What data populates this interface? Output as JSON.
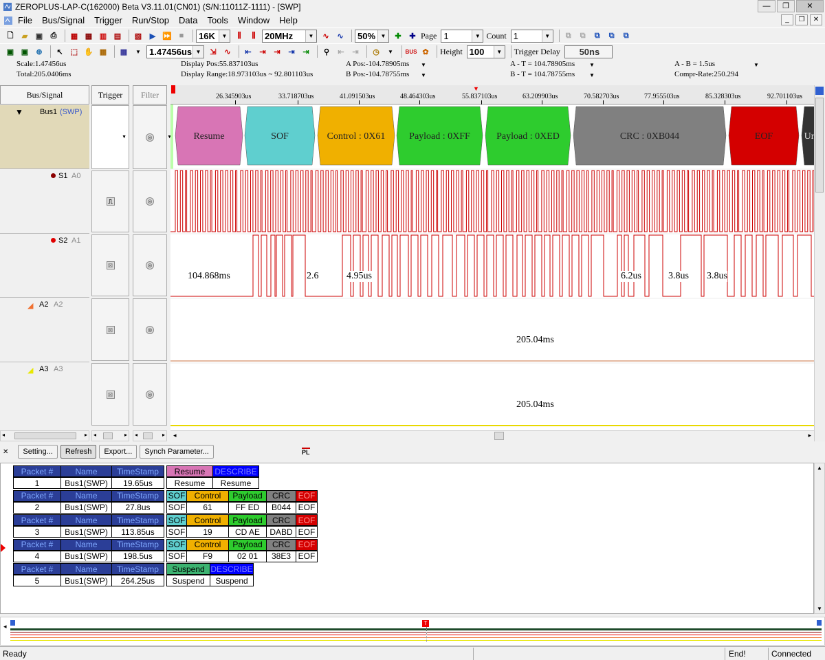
{
  "window": {
    "title": "ZEROPLUS-LAP-C(162000) Beta V3.11.01(CN01) (S/N:11011Z-1111) - [SWP]"
  },
  "menu": [
    "File",
    "Bus/Signal",
    "Trigger",
    "Run/Stop",
    "Data",
    "Tools",
    "Window",
    "Help"
  ],
  "toolbar": {
    "memory": "16K",
    "frequency": "20MHz",
    "zoom": "50%",
    "page_label": "Page",
    "page_value": "1",
    "count_label": "Count",
    "count_value": "1",
    "scale_value": "1.47456us",
    "height_label": "Height",
    "height_value": "100",
    "trigger_delay_label": "Trigger Delay",
    "trigger_delay_value": "50ns"
  },
  "info": {
    "scale": "Scale:1.47456us",
    "total": "Total:205.0406ms",
    "display_pos": "Display Pos:55.837103us",
    "display_range": "Display Range:18.973103us ~ 92.801103us",
    "a_pos": "A Pos:-104.78905ms",
    "b_pos": "B Pos:-104.78755ms",
    "a_t": "A - T = 104.78905ms",
    "b_t": "B - T = 104.78755ms",
    "a_b": "A - B = 1.5us",
    "compr": "Compr-Rate:250.294"
  },
  "headers": {
    "bus_signal": "Bus/Signal",
    "trigger": "Trigger",
    "filter": "Filter"
  },
  "signals": [
    {
      "name": "Bus1",
      "sub": "(SWP)"
    },
    {
      "name": "S1",
      "sub": "A0",
      "color": "#8b0000"
    },
    {
      "name": "S2",
      "sub": "A1",
      "color": "#e00000"
    },
    {
      "name": "A2",
      "sub": "A2",
      "color": "#f07030"
    },
    {
      "name": "A3",
      "sub": "A3",
      "color": "#f0f000"
    }
  ],
  "ruler_ticks": [
    "26.345903us",
    "33.718703us",
    "41.091503us",
    "48.464303us",
    "55.837103us",
    "63.209903us",
    "70.582703us",
    "77.955503us",
    "85.328303us",
    "92.701103us"
  ],
  "bus_segments": [
    {
      "label": "Resume",
      "color": "#d875b5"
    },
    {
      "label": "SOF",
      "color": "#5fcfcf"
    },
    {
      "label": "Control : 0X61",
      "color": "#f0b000"
    },
    {
      "label": "Payload : 0XFF",
      "color": "#2ecc2e"
    },
    {
      "label": "Payload : 0XED",
      "color": "#2ecc2e"
    },
    {
      "label": "CRC : 0XB044",
      "color": "#808080"
    },
    {
      "label": "EOF",
      "color": "#d40000"
    },
    {
      "label": "Ur",
      "color": "#333333"
    }
  ],
  "s2_labels": [
    "104.868ms",
    "2.6",
    "4.95us",
    "6.2us",
    "3.8us",
    "3.8us"
  ],
  "a2_label": "205.04ms",
  "a3_label": "205.04ms",
  "buttons": {
    "setting": "Setting...",
    "refresh": "Refresh",
    "export": "Export...",
    "synch": "Synch Parameter..."
  },
  "pl_label": "PL",
  "packet_headers": {
    "num": "Packet #",
    "name": "Name",
    "ts": "TimeStamp"
  },
  "packets": [
    {
      "num": "1",
      "name": "Bus1(SWP)",
      "ts": "19.65us",
      "fields": [
        {
          "h": "Resume",
          "v": "Resume",
          "color": "#d875b5"
        },
        {
          "h": "DESCRIBE",
          "v": "Resume",
          "color": "#0000ff"
        }
      ]
    },
    {
      "num": "2",
      "name": "Bus1(SWP)",
      "ts": "27.8us",
      "fields": [
        {
          "h": "SOF",
          "v": "SOF",
          "color": "#5fcfcf"
        },
        {
          "h": "Control",
          "v": "61",
          "color": "#f0b000"
        },
        {
          "h": "Payload",
          "v": "FF  ED",
          "color": "#2ecc2e"
        },
        {
          "h": "CRC",
          "v": "B044",
          "color": "#808080"
        },
        {
          "h": "EOF",
          "v": "EOF",
          "color": "#d40000"
        }
      ]
    },
    {
      "num": "3",
      "name": "Bus1(SWP)",
      "ts": "113.85us",
      "fields": [
        {
          "h": "SOF",
          "v": "SOF",
          "color": "#5fcfcf"
        },
        {
          "h": "Control",
          "v": "19",
          "color": "#f0b000"
        },
        {
          "h": "Payload",
          "v": "CD  AE",
          "color": "#2ecc2e"
        },
        {
          "h": "CRC",
          "v": "DABD",
          "color": "#808080"
        },
        {
          "h": "EOF",
          "v": "EOF",
          "color": "#d40000"
        }
      ]
    },
    {
      "num": "4",
      "name": "Bus1(SWP)",
      "ts": "198.5us",
      "fields": [
        {
          "h": "SOF",
          "v": "SOF",
          "color": "#5fcfcf"
        },
        {
          "h": "Control",
          "v": "F9",
          "color": "#f0b000"
        },
        {
          "h": "Payload",
          "v": "02  01",
          "color": "#2ecc2e"
        },
        {
          "h": "CRC",
          "v": "38E3",
          "color": "#808080"
        },
        {
          "h": "EOF",
          "v": "EOF",
          "color": "#d40000"
        }
      ]
    },
    {
      "num": "5",
      "name": "Bus1(SWP)",
      "ts": "264.25us",
      "fields": [
        {
          "h": "Suspend",
          "v": "Suspend",
          "color": "#3cb371"
        },
        {
          "h": "DESCRIBE",
          "v": "Suspend",
          "color": "#0000ff"
        }
      ]
    }
  ],
  "status": {
    "ready": "Ready",
    "end": "End!",
    "connected": "Connected"
  }
}
